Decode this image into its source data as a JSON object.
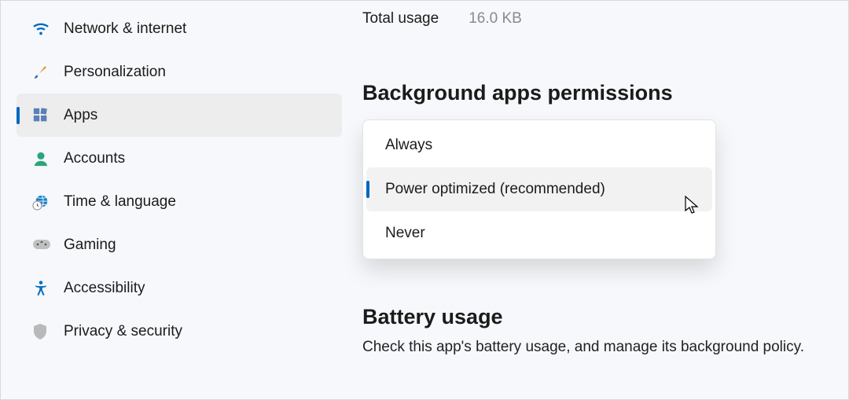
{
  "sidebar": {
    "items": [
      {
        "label": "Network & internet",
        "icon": "wifi-icon",
        "selected": false
      },
      {
        "label": "Personalization",
        "icon": "brush-icon",
        "selected": false
      },
      {
        "label": "Apps",
        "icon": "apps-icon",
        "selected": true
      },
      {
        "label": "Accounts",
        "icon": "person-icon",
        "selected": false
      },
      {
        "label": "Time & language",
        "icon": "globe-clock-icon",
        "selected": false
      },
      {
        "label": "Gaming",
        "icon": "gamepad-icon",
        "selected": false
      },
      {
        "label": "Accessibility",
        "icon": "accessibility-icon",
        "selected": false
      },
      {
        "label": "Privacy & security",
        "icon": "shield-icon",
        "selected": false
      }
    ]
  },
  "main": {
    "total_usage_label": "Total usage",
    "total_usage_value": "16.0 KB",
    "bg_perm_heading": "Background apps permissions",
    "dropdown": {
      "options": [
        {
          "label": "Always"
        },
        {
          "label": "Power optimized (recommended)"
        },
        {
          "label": "Never"
        }
      ],
      "selected_index": 1
    },
    "battery_heading": "Battery usage",
    "battery_desc": "Check this app's battery usage, and manage its background policy."
  }
}
